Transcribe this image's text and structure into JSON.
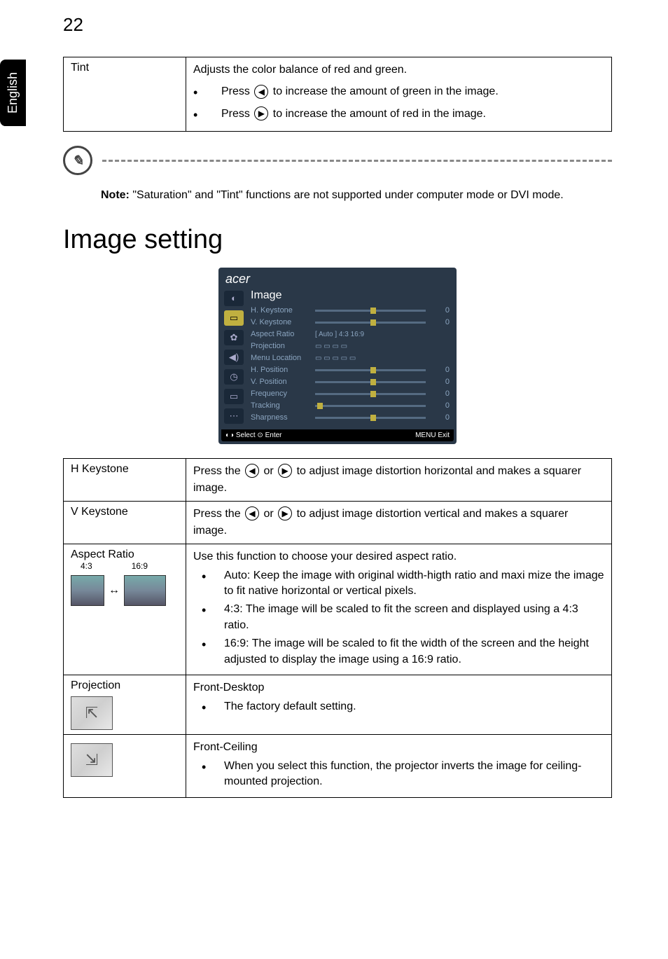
{
  "page_number": "22",
  "side_tab": "English",
  "tint_table": {
    "label": "Tint",
    "description": "Adjusts the color balance of red and green.",
    "bullets": [
      {
        "prefix": "Press ",
        "icon": "◀",
        "suffix": " to increase the amount of green in the image."
      },
      {
        "prefix": "Press ",
        "icon": "▶",
        "suffix": " to increase the amount of red in the image."
      }
    ]
  },
  "note": {
    "label": "Note:",
    "text": " \"Saturation\" and \"Tint\" functions are not supported under computer mode or DVI mode."
  },
  "section_title": "Image setting",
  "osd": {
    "brand": "acer",
    "title": "Image",
    "rows": [
      {
        "label": "H. Keystone",
        "value": "0"
      },
      {
        "label": "V. Keystone",
        "value": "0"
      },
      {
        "label": "Aspect Ratio",
        "opts": "[ Auto ]   4:3   16:9"
      },
      {
        "label": "Projection",
        "opts": ""
      },
      {
        "label": "Menu Location",
        "opts": ""
      },
      {
        "label": "H. Position",
        "value": "0"
      },
      {
        "label": "V. Position",
        "value": "0"
      },
      {
        "label": "Frequency",
        "value": "0"
      },
      {
        "label": "Tracking",
        "value": "0"
      },
      {
        "label": "Sharpness",
        "value": "0"
      }
    ],
    "footer_left": "◐◑ Select      ⊙ Enter",
    "footer_right": "MENU Exit"
  },
  "image_table": {
    "h_keystone": {
      "label": "H Keystone",
      "prefix": "Press the ",
      "mid": " or ",
      "suffix": " to adjust image distortion horizontal and makes a squarer image."
    },
    "v_keystone": {
      "label": "V Keystone",
      "prefix": "Press the ",
      "mid": " or ",
      "suffix": " to adjust image distortion vertical and makes a squarer image."
    },
    "aspect": {
      "label": "Aspect Ratio",
      "ratio_43": "4:3",
      "ratio_169": "16:9",
      "desc": "Use this function to choose your desired aspect ratio.",
      "bullets": [
        "Auto: Keep the image with original width-higth ratio and maxi mize the image to fit native horizontal or vertical pixels.",
        "4:3: The image will be scaled to fit the screen and displayed using a 4:3 ratio.",
        "16:9: The  image will be scaled to fit the width of the screen and the height adjusted to display the image using a 16:9 ratio."
      ]
    },
    "projection_front_desktop": {
      "label": "Projection",
      "title": "Front-Desktop",
      "bullet": "The factory default setting."
    },
    "projection_front_ceiling": {
      "title": "Front-Ceiling",
      "bullet": "When you select this function, the projector inverts the image for ceiling-mounted projection."
    }
  }
}
